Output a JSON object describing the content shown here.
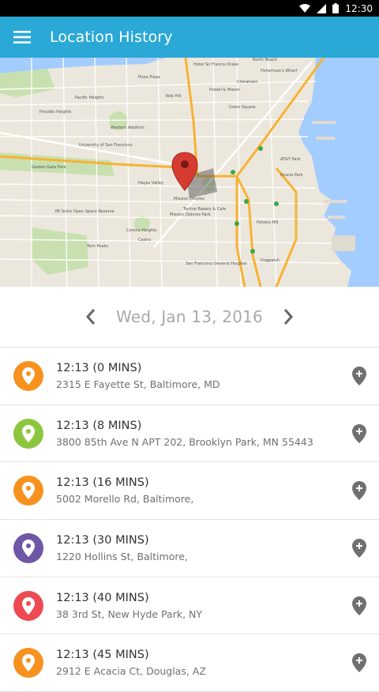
{
  "status_bar": {
    "time": "12:30"
  },
  "app_bar": {
    "title": "Location History"
  },
  "date_nav": {
    "date": "Wed, Jan 13, 2016"
  },
  "map_labels": [
    "Hotel Sir Francis Drake",
    "Pizza Plaza",
    "Fisherman's Wharf",
    "Powell & Mason",
    "University of San Francisco",
    "Presidio Heights",
    "Golden Gate Park",
    "Mt Sutro Open Space Reserve",
    "Twin Peaks",
    "Mission Dolores",
    "San Francisco General Hospital",
    "Potrero Hill",
    "AT&T Park",
    "Oracle Park",
    "Dogpatch",
    "Corona Heights",
    "Tartine Bakery & Cafe",
    "Mission Dolores Park",
    "Castro",
    "Hayes Valley",
    "Western Addition",
    "Pacific Heights",
    "Union Square",
    "Nob Hill",
    "Chinatown",
    "North Beach"
  ],
  "locations": [
    {
      "time": "12:13 (0 MINS)",
      "address": "2315 E Fayette St, Baltimore, MD",
      "color": "#f7921e"
    },
    {
      "time": "12:13 (8 MINS)",
      "address": "3800 85th Ave N APT 202, Brooklyn Park, MN 55443",
      "color": "#8cc63e"
    },
    {
      "time": "12:13 (16 MINS)",
      "address": "5002 Morello Rd, Baltimore,",
      "color": "#f7921e"
    },
    {
      "time": "12:13 (30 MINS)",
      "address": "1220 Hollins St, Baltimore,",
      "color": "#6f56a6"
    },
    {
      "time": "12:13 (40 MINS)",
      "address": "38 3rd St, New Hyde Park, NY",
      "color": "#ed4a53"
    },
    {
      "time": "12:13 (45 MINS)",
      "address": "2912 E Acacia Ct, Douglas, AZ",
      "color": "#f7921e"
    }
  ]
}
